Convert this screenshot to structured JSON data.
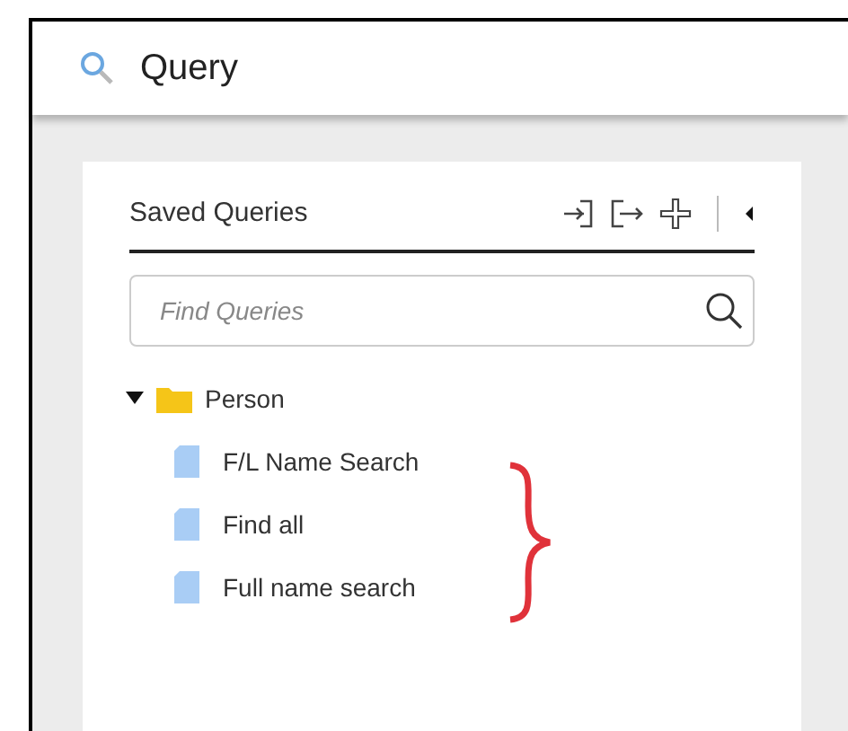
{
  "header": {
    "title": "Query"
  },
  "panel": {
    "title": "Saved Queries"
  },
  "search": {
    "placeholder": "Find Queries"
  },
  "tree": [
    {
      "label": "Person",
      "kind": "folder",
      "expanded": true,
      "children": [
        {
          "label": "F/L Name Search",
          "kind": "query"
        },
        {
          "label": "Find all",
          "kind": "query"
        },
        {
          "label": "Full name search",
          "kind": "query"
        }
      ]
    }
  ]
}
